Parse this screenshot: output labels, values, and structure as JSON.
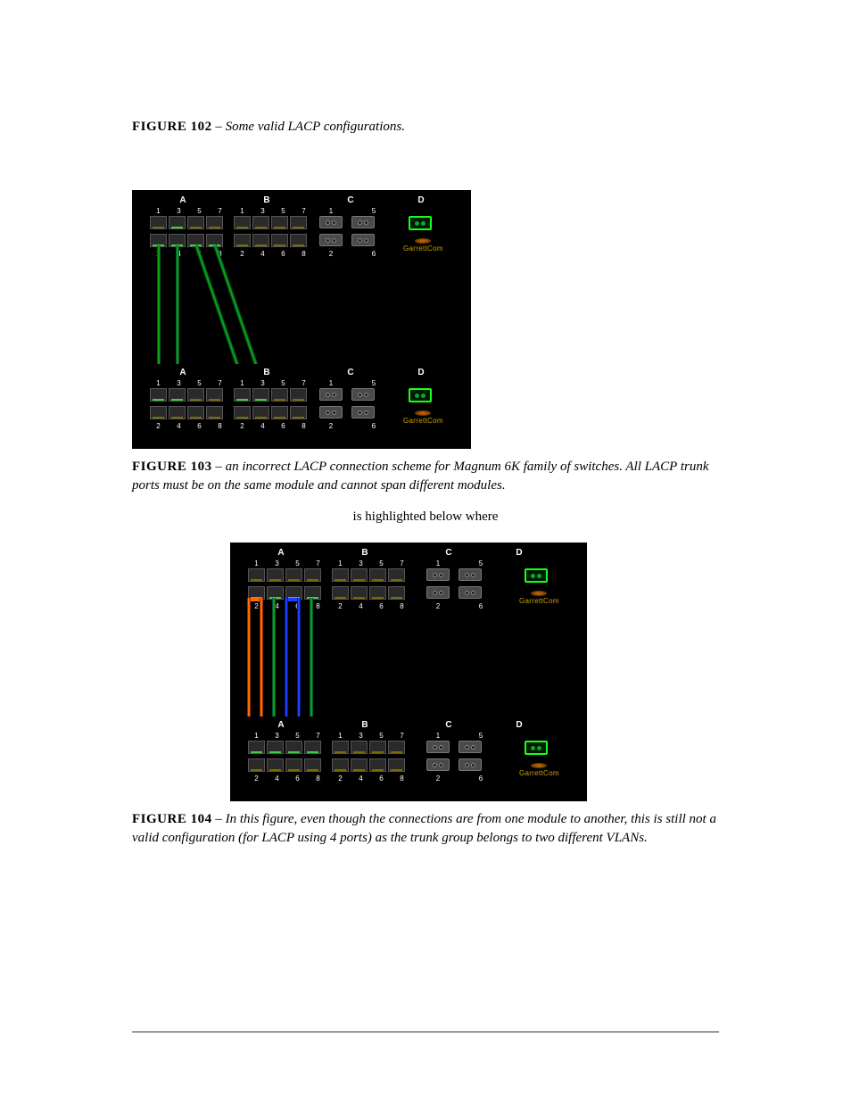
{
  "figures": {
    "fig102": {
      "label": "FIGURE 102",
      "sep": " – ",
      "text": "Some valid LACP configurations."
    },
    "fig103": {
      "label": "FIGURE 103",
      "sep": " – ",
      "text": "an incorrect LACP connection scheme for Magnum 6K family of switches. All LACP trunk ports must be on the same module and cannot span different modules."
    },
    "fig104": {
      "label": "FIGURE 104",
      "sep": " – ",
      "text": "In this figure, even though the connections are from one module to another, this is still not a valid configuration (for LACP using 4 ports) as the trunk group belongs to two different VLANs."
    }
  },
  "bodyText": "is highlighted below where",
  "switch": {
    "sections": [
      "A",
      "B",
      "C",
      "D"
    ],
    "topPortNumbers": [
      "1",
      "3",
      "5",
      "7"
    ],
    "bottomPortNumbers": [
      "2",
      "4",
      "6",
      "8"
    ],
    "fiberTopNumbers": [
      "1",
      "5"
    ],
    "fiberBottomNumbers": [
      "2",
      "6"
    ],
    "brand": "GarrettCom"
  }
}
